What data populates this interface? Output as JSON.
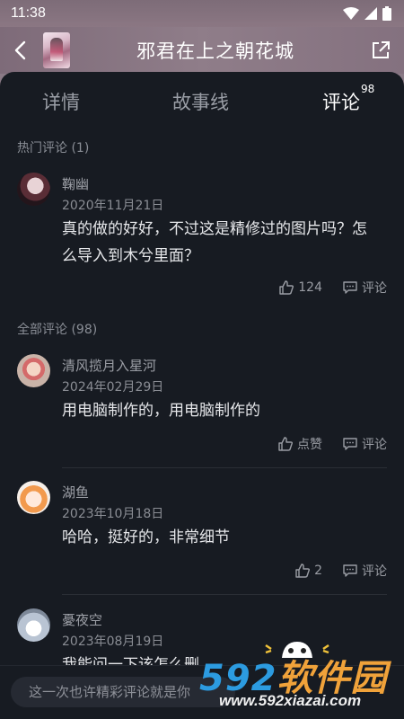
{
  "status_bar": {
    "time": "11:38"
  },
  "header": {
    "title": "邪君在上之朝花城"
  },
  "tabs": [
    {
      "label": "详情"
    },
    {
      "label": "故事线"
    },
    {
      "label": "评论",
      "count": "98"
    }
  ],
  "hot_section": {
    "label": "热门评论 (1)"
  },
  "all_section": {
    "label": "全部评论 (98)"
  },
  "hot_comments": [
    {
      "name": "鞠幽",
      "date": "2020年11月21日",
      "text": "真的做的好好，不过这是精修过的图片吗？怎么导入到木兮里面？",
      "likes": "124",
      "reply_label": "评论"
    }
  ],
  "comments": [
    {
      "name": "清风揽月入星河",
      "date": "2024年02月29日",
      "text": "用电脑制作的，用电脑制作的",
      "likes": "点赞",
      "reply_label": "评论"
    },
    {
      "name": "湖鱼",
      "date": "2023年10月18日",
      "text": "哈哈，挺好的，非常细节",
      "likes": "2",
      "reply_label": "评论"
    },
    {
      "name": "憂夜空",
      "date": "2023年08月19日",
      "text": "我能问一下该怎么删…"
    }
  ],
  "comment_input": {
    "placeholder": "这一次也许精彩评论就是你"
  },
  "watermark": {
    "brand_num": "592",
    "brand_cn": "软件园",
    "url": "www.592xiazai.com"
  },
  "colors": {
    "accent_header": "#8b7783",
    "sheet_bg": "#171b22"
  }
}
